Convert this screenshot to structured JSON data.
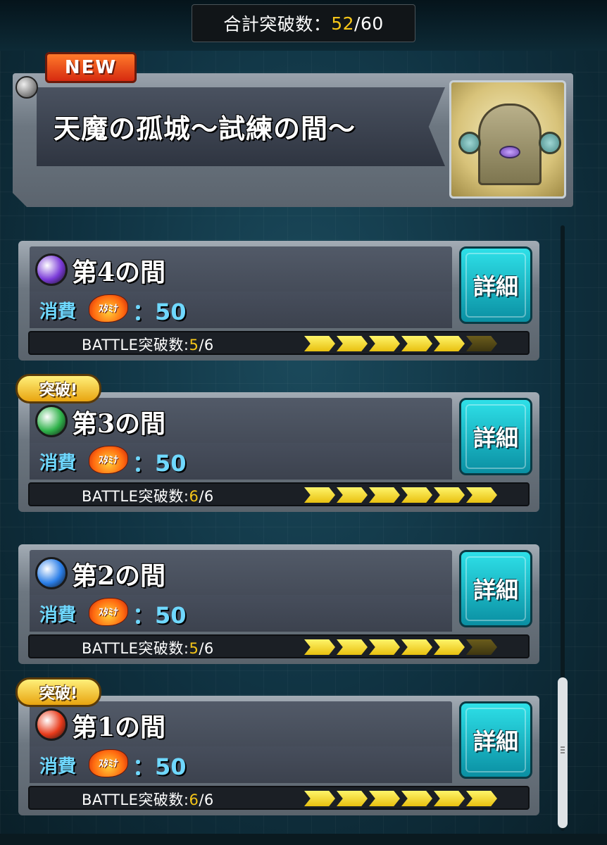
{
  "header_bar": {
    "label": "合計突破数：",
    "current": "52",
    "sep": "/",
    "total": "60"
  },
  "quest": {
    "badge": "NEW",
    "title": "天魔の孤城～試練の間～",
    "thumbnail_icon": "castle-gate-icon"
  },
  "stages": [
    {
      "title": "第4の間",
      "element": "dark",
      "element_color": "#7a3ad8",
      "cost_label": "消費",
      "stamina_label": "ｽﾀﾐﾅ",
      "cost_value": "：50",
      "detail_label": "詳細",
      "battle_label": "BATTLE突破数:",
      "battle_current": "5",
      "battle_total": "/6",
      "progress": 5,
      "max": 6,
      "cleared": false,
      "cleared_label": ""
    },
    {
      "title": "第3の間",
      "element": "wood",
      "element_color": "#2fb24a",
      "cost_label": "消費",
      "stamina_label": "ｽﾀﾐﾅ",
      "cost_value": "：50",
      "detail_label": "詳細",
      "battle_label": "BATTLE突破数:",
      "battle_current": "6",
      "battle_total": "/6",
      "progress": 6,
      "max": 6,
      "cleared": true,
      "cleared_label": "突破!"
    },
    {
      "title": "第2の間",
      "element": "water",
      "element_color": "#2a7ee8",
      "cost_label": "消費",
      "stamina_label": "ｽﾀﾐﾅ",
      "cost_value": "：50",
      "detail_label": "詳細",
      "battle_label": "BATTLE突破数:",
      "battle_current": "5",
      "battle_total": "/6",
      "progress": 5,
      "max": 6,
      "cleared": false,
      "cleared_label": ""
    },
    {
      "title": "第1の間",
      "element": "fire",
      "element_color": "#e83a1a",
      "cost_label": "消費",
      "stamina_label": "ｽﾀﾐﾅ",
      "cost_value": "：50",
      "detail_label": "詳細",
      "battle_label": "BATTLE突破数:",
      "battle_current": "6",
      "battle_total": "/6",
      "progress": 6,
      "max": 6,
      "cleared": true,
      "cleared_label": "突破!"
    }
  ],
  "colors": {
    "accent_yellow": "#f5c518",
    "cost_cyan": "#6fd8ff",
    "detail_button": "#1ec0d0"
  }
}
